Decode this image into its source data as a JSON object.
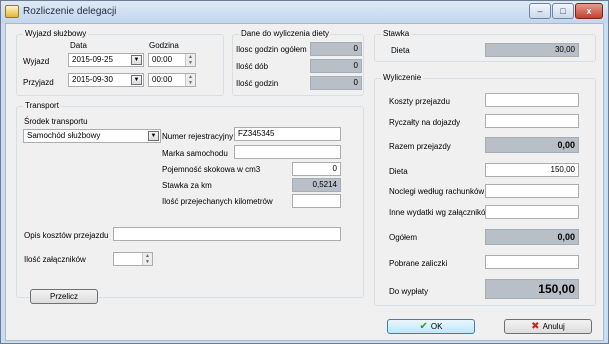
{
  "window": {
    "title": "Rozliczenie delegacji",
    "app_icon": "folder-icon",
    "minimize_glyph": "–",
    "maximize_glyph": "□",
    "close_glyph": "x"
  },
  "wyjazd": {
    "title": "Wyjazd służbowy",
    "col_date": "Data",
    "col_hour": "Godzina",
    "departure_label": "Wyjazd",
    "departure_date": "2015-09-25",
    "departure_time": "00:00",
    "arrival_label": "Przyjazd",
    "arrival_date": "2015-09-30",
    "arrival_time": "00:00"
  },
  "dieta_data": {
    "title": "Dane do wyliczenia diety",
    "rows": [
      {
        "label": "Ilosc godzin ogółem",
        "value": "0"
      },
      {
        "label": "Ilość dób",
        "value": "0"
      },
      {
        "label": "Ilość godzin",
        "value": "0"
      }
    ]
  },
  "stawka": {
    "title": "Stawka",
    "dieta_label": "Dieta",
    "dieta_value": "30,00"
  },
  "transport": {
    "title": "Transport",
    "srodek_label": "Środek transportu",
    "srodek_value": "Samochód służbowy",
    "nr_rej_label": "Numer rejestracyjny",
    "nr_rej_value": "FZ345345",
    "marka_label": "Marka samochodu",
    "marka_value": "",
    "pojemnosc_label": "Pojemność skokowa w cm3",
    "pojemnosc_value": "0",
    "stawka_km_label": "Stawka za km",
    "stawka_km_value": "0,5214",
    "ilosc_km_label": "Ilość przejechanych kilometrów",
    "ilosc_km_value": "",
    "opis_label": "Opis kosztów przejazdu",
    "opis_value": "",
    "zalaczniki_label": "Ilość załączników",
    "zalaczniki_value": ""
  },
  "wyliczenie": {
    "title": "Wyliczenie",
    "koszty_label": "Koszty przejazdu",
    "koszty_value": "",
    "ryczalty_label": "Ryczałty na dojazdy",
    "ryczalty_value": "",
    "razem_label": "Razem przejazdy",
    "razem_value": "0,00",
    "dieta_label": "Dieta",
    "dieta_value": "150,00",
    "noclegi_label": "Noclegi według rachunków",
    "noclegi_value": "",
    "inne_label": "Inne wydatki wg załączników",
    "inne_value": "",
    "ogolem_label": "Ogółem",
    "ogolem_value": "0,00",
    "zaliczki_label": "Pobrane zaliczki",
    "zaliczki_value": "",
    "do_wyplaty_label": "Do wypłaty",
    "do_wyplaty_value": "150,00"
  },
  "buttons": {
    "przelicz": "Przelicz",
    "ok": "OK",
    "anuluj": "Anuluj",
    "ok_glyph": "✔",
    "anuluj_glyph": "✖"
  }
}
